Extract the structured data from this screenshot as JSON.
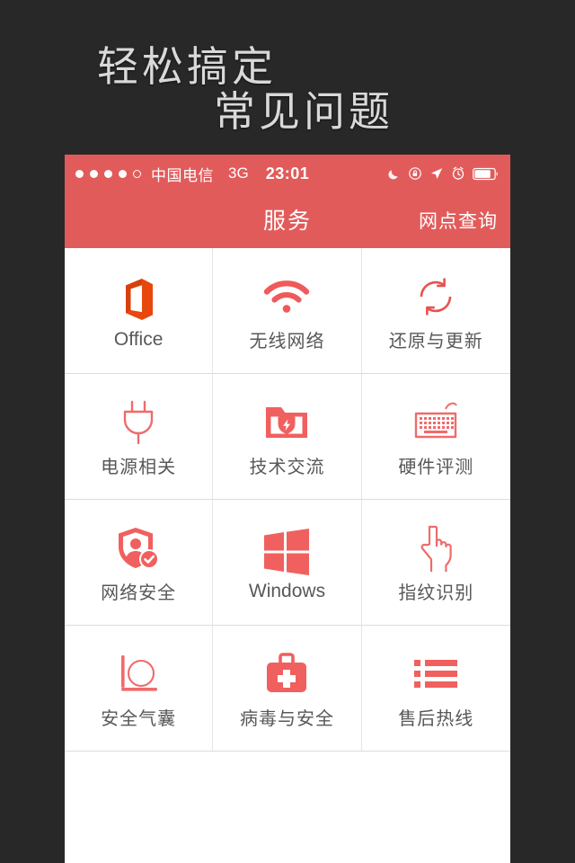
{
  "hero": {
    "line1": "轻松搞定",
    "line2": "常见问题",
    "text_color": "#d9d9d9",
    "background": "#282828"
  },
  "phone": {
    "accent_color": "#e25b5b",
    "card_background": "#ffffff",
    "statusbar": {
      "signal_dots": {
        "filled": 4,
        "total": 5
      },
      "carrier": "中国电信",
      "network": "3G",
      "time": "23:01",
      "right_icons": [
        "moon-icon",
        "rotation-lock-icon",
        "location-arrow-icon",
        "alarm-clock-icon",
        "battery-icon"
      ]
    },
    "navbar": {
      "title": "服务",
      "right_action": "网点查询"
    },
    "grid": {
      "items": [
        {
          "label": "Office",
          "icon": "office-icon",
          "latin": true
        },
        {
          "label": "无线网络",
          "icon": "wifi-icon",
          "latin": false
        },
        {
          "label": "还原与更新",
          "icon": "refresh-sync-icon",
          "latin": false
        },
        {
          "label": "电源相关",
          "icon": "power-plug-icon",
          "latin": false
        },
        {
          "label": "技术交流",
          "icon": "folder-shield-icon",
          "latin": false
        },
        {
          "label": "硬件评测",
          "icon": "keyboard-icon",
          "latin": false
        },
        {
          "label": "网络安全",
          "icon": "shield-user-check-icon",
          "latin": false
        },
        {
          "label": "Windows",
          "icon": "windows-logo-icon",
          "latin": true
        },
        {
          "label": "指纹识别",
          "icon": "pointing-hand-icon",
          "latin": false
        },
        {
          "label": "安全气囊",
          "icon": "airbag-icon",
          "latin": false
        },
        {
          "label": "病毒与安全",
          "icon": "medical-kit-icon",
          "latin": false
        },
        {
          "label": "售后热线",
          "icon": "list-lines-icon",
          "latin": false
        }
      ]
    }
  }
}
